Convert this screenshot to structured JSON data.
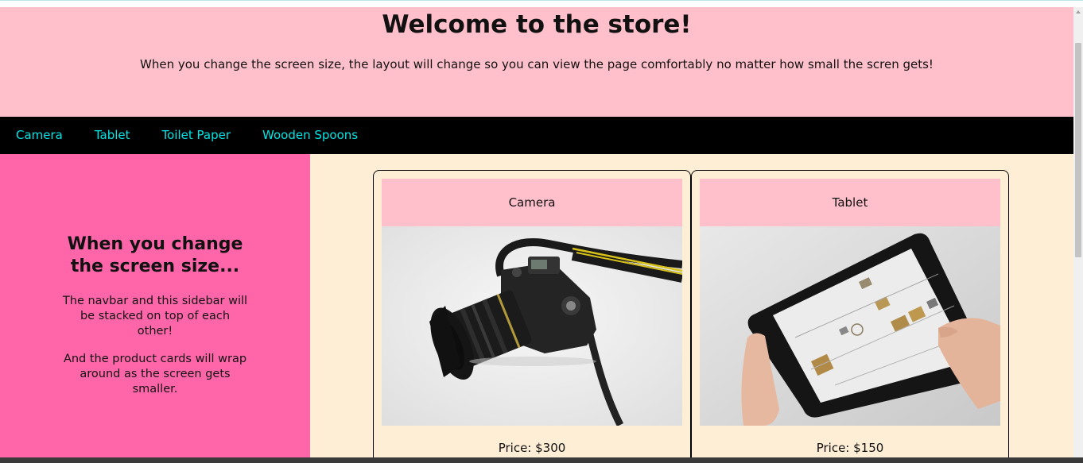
{
  "header": {
    "title": "Welcome to the store!",
    "subtitle": "When you change the screen size, the layout will change so you can view the page comfortably no matter how small the scren gets!"
  },
  "navbar": {
    "items": [
      {
        "label": "Camera"
      },
      {
        "label": "Tablet"
      },
      {
        "label": "Toilet Paper"
      },
      {
        "label": "Wooden Spoons"
      }
    ]
  },
  "sidebar": {
    "heading": "When you change the screen size...",
    "paragraph1": "The navbar and this sidebar will be stacked on top of each other!",
    "paragraph2": "And the product cards will wrap around as the screen gets smaller."
  },
  "products": [
    {
      "name": "Camera",
      "price": "Price: $300",
      "image": "camera-photo"
    },
    {
      "name": "Tablet",
      "price": "Price: $150",
      "image": "tablet-photo"
    }
  ],
  "colors": {
    "header_bg": "#ffc0cb",
    "nav_bg": "#000000",
    "nav_link": "#00e5e5",
    "sidebar_bg": "#ff66aa",
    "main_bg": "#ffeed6"
  }
}
